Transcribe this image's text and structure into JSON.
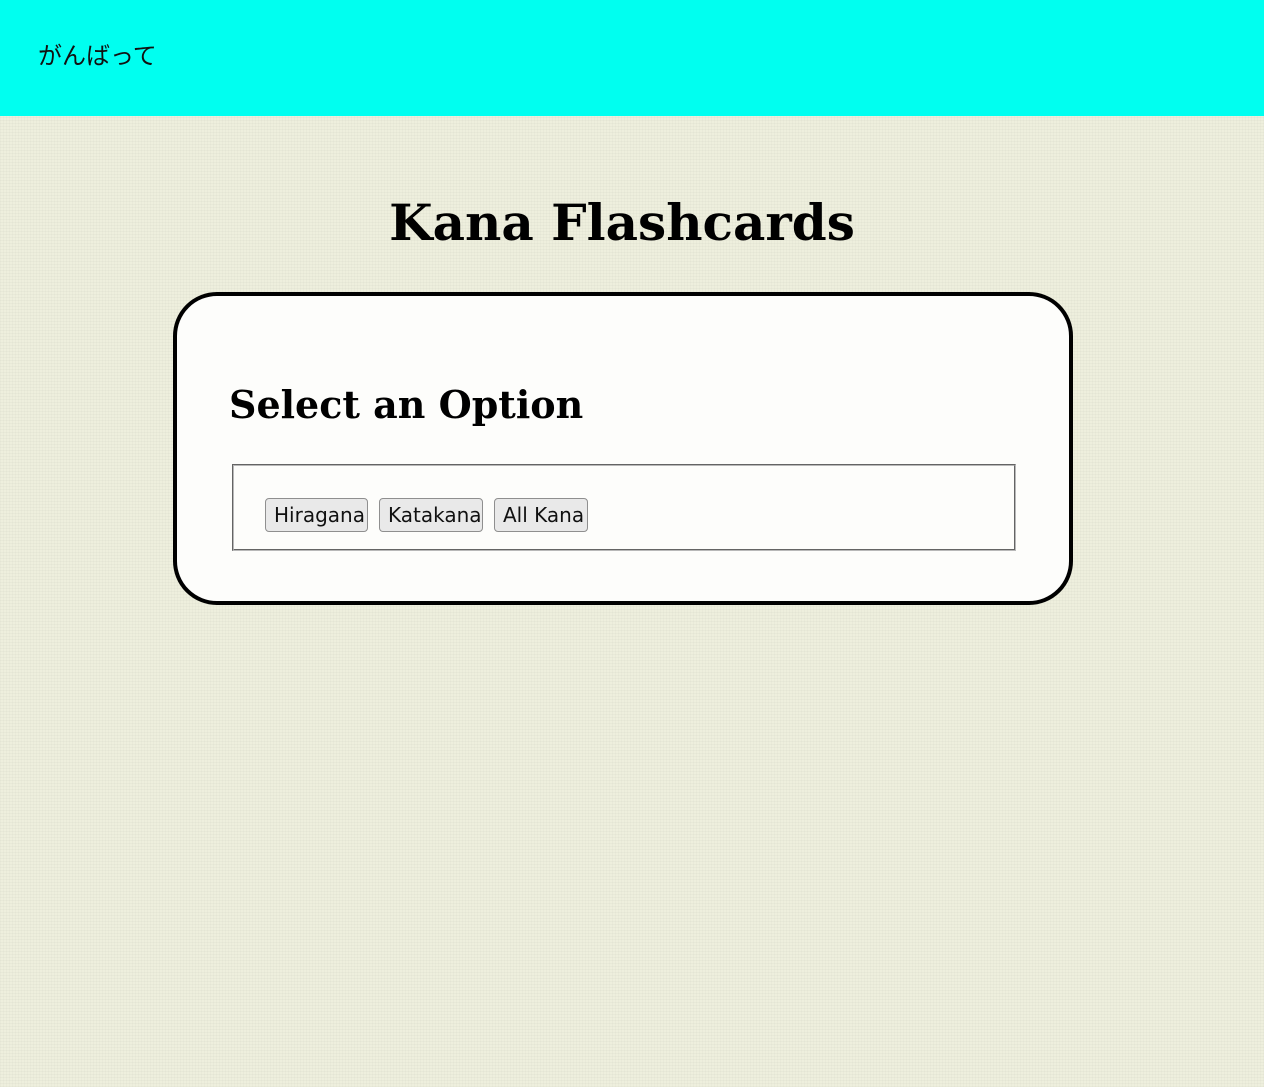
{
  "header": {
    "brand_text": "がんばって",
    "background_color": "#00fff0"
  },
  "page": {
    "title": "Kana Flashcards",
    "background_color": "#eeefdd"
  },
  "card": {
    "heading": "Select an Option",
    "options": [
      {
        "label": "Hiragana"
      },
      {
        "label": "Katakana"
      },
      {
        "label": "All Kana"
      }
    ]
  }
}
